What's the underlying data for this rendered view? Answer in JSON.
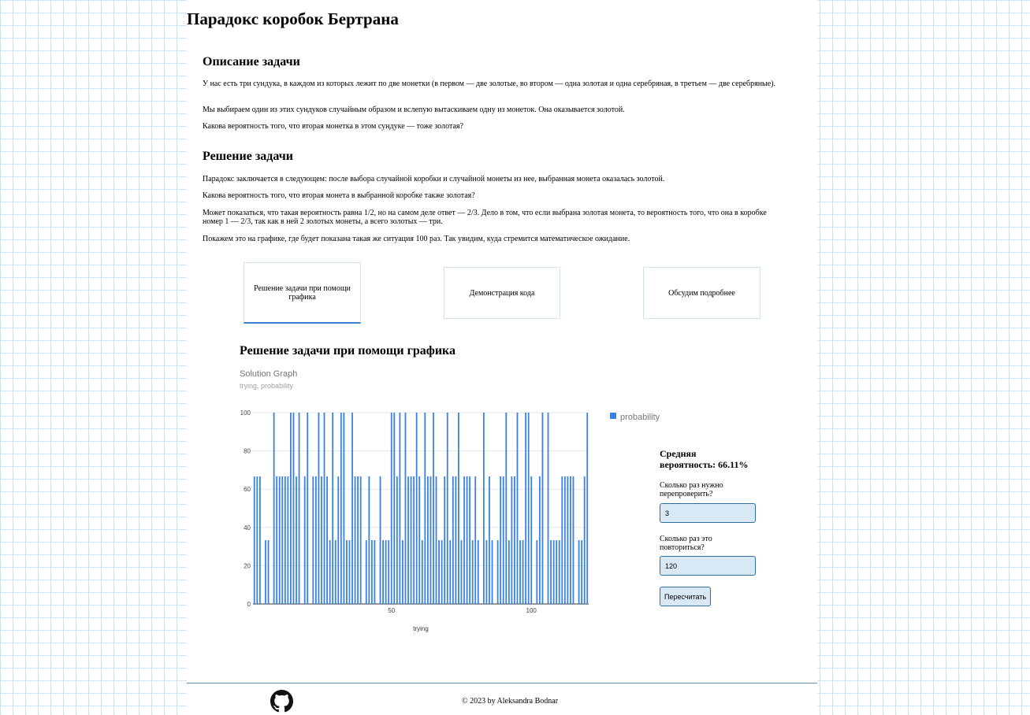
{
  "page": {
    "title": "Парадокс коробок Бертрана"
  },
  "description": {
    "heading": "Описание задачи",
    "paragraphs": [
      "У нас есть три сундука, в каждом из которых лежит по две монетки (в первом — две золотые, во втором — одна золотая и одна серебряная, в третьем — две серебряные).",
      "Мы выбираем один из этих сундуков случайным образом и вслепую вытаскиваем одну из монеток. Она оказывается золотой.",
      "Какова вероятность того, что вторая монетка в этом сундуке — тоже золотая?"
    ]
  },
  "solution": {
    "heading": "Решение задачи",
    "paragraphs": [
      "Парадокс заключается в следующем: после выбора случайной коробки и случайной монеты из нее, выбранная монета оказалась золотой.",
      "Какова вероятность того, что вторая монета в выбранной коробке также золотая?",
      "Может показаться, что такая вероятность равна 1/2, но на самом деле ответ — 2/3. Дело в том, что если выбрана золотая монета, то вероятность того, что она в коробке номер 1 — 2/3, так как в ней 2 золотых монеты, а всего золотых — три.",
      "Покажем это на графике, где будет показана такая же ситуация 100 раз. Так увидим, куда стремится математическое ожидание."
    ]
  },
  "tabs": [
    {
      "label": "Решение задачи при помощи графика",
      "active": true
    },
    {
      "label": "Демонстрация кода",
      "active": false
    },
    {
      "label": "Обсудим подробнее",
      "active": false
    }
  ],
  "panel": {
    "heading": "Решение задачи при помощи графика"
  },
  "chart_data": {
    "type": "bar",
    "title": "Solution Graph",
    "subtitle": "trying, probability",
    "xlabel": "trying",
    "ylabel": "",
    "xlim": [
      0,
      120
    ],
    "ylim": [
      0,
      100
    ],
    "y_ticks": [
      0,
      20,
      40,
      60,
      80,
      100
    ],
    "x_ticks": [
      50,
      100
    ],
    "grid": true,
    "legend_position": "right",
    "color": "#3b82e0",
    "series": [
      {
        "name": "probability",
        "x": [
          1,
          2,
          3,
          4,
          5,
          6,
          7,
          8,
          9,
          10,
          11,
          12,
          13,
          14,
          15,
          16,
          17,
          18,
          19,
          20,
          21,
          22,
          23,
          24,
          25,
          26,
          27,
          28,
          29,
          30,
          31,
          32,
          33,
          34,
          35,
          36,
          37,
          38,
          39,
          40,
          41,
          42,
          43,
          44,
          45,
          46,
          47,
          48,
          49,
          50,
          51,
          52,
          53,
          54,
          55,
          56,
          57,
          58,
          59,
          60,
          61,
          62,
          63,
          64,
          65,
          66,
          67,
          68,
          69,
          70,
          71,
          72,
          73,
          74,
          75,
          76,
          77,
          78,
          79,
          80,
          81,
          82,
          83,
          84,
          85,
          86,
          87,
          88,
          89,
          90,
          91,
          92,
          93,
          94,
          95,
          96,
          97,
          98,
          99,
          100,
          101,
          102,
          103,
          104,
          105,
          106,
          107,
          108,
          109,
          110,
          111,
          112,
          113,
          114,
          115,
          116,
          117,
          118,
          119,
          120
        ],
        "values": [
          66.67,
          66.67,
          66.67,
          0,
          33.33,
          33.33,
          0,
          100,
          66.67,
          66.67,
          66.67,
          66.67,
          66.67,
          100,
          100,
          66.67,
          100,
          0,
          66.67,
          100,
          0,
          66.67,
          66.67,
          100,
          66.67,
          100,
          66.67,
          33.33,
          100,
          33.33,
          66.67,
          100,
          100,
          33.33,
          33.33,
          100,
          66.67,
          66.67,
          66.67,
          0,
          33.33,
          66.67,
          33.33,
          33.33,
          0,
          66.67,
          33.33,
          33.33,
          33.33,
          100,
          100,
          66.67,
          100,
          33.33,
          100,
          66.67,
          66.67,
          66.67,
          100,
          66.67,
          33.33,
          100,
          66.67,
          66.67,
          100,
          66.67,
          33.33,
          33.33,
          66.67,
          100,
          33.33,
          66.67,
          66.67,
          100,
          33.33,
          66.67,
          66.67,
          66.67,
          33.33,
          66.67,
          33.33,
          0,
          100,
          33.33,
          66.67,
          33.33,
          0,
          33.33,
          66.67,
          66.67,
          100,
          33.33,
          66.67,
          66.67,
          100,
          33.33,
          33.33,
          100,
          100,
          66.67,
          0,
          33.33,
          66.67,
          100,
          0,
          100,
          33.33,
          33.33,
          33.33,
          33.33,
          66.67,
          66.67,
          66.67,
          66.67,
          66.67,
          0,
          33.33,
          33.33,
          66.67,
          100
        ]
      }
    ]
  },
  "sidebar": {
    "avg_label": "Средняя вероятность: 66.11%",
    "recheck_label": "Сколько раз нужно перепроверить?",
    "recheck_value": "3",
    "repeat_label": "Сколько раз это повториться?",
    "repeat_value": "120",
    "recalc_label": "Пересчитать"
  },
  "footer": {
    "copyright": "© 2023 by Aleksandra Bodnar",
    "github_icon": "github-icon"
  }
}
